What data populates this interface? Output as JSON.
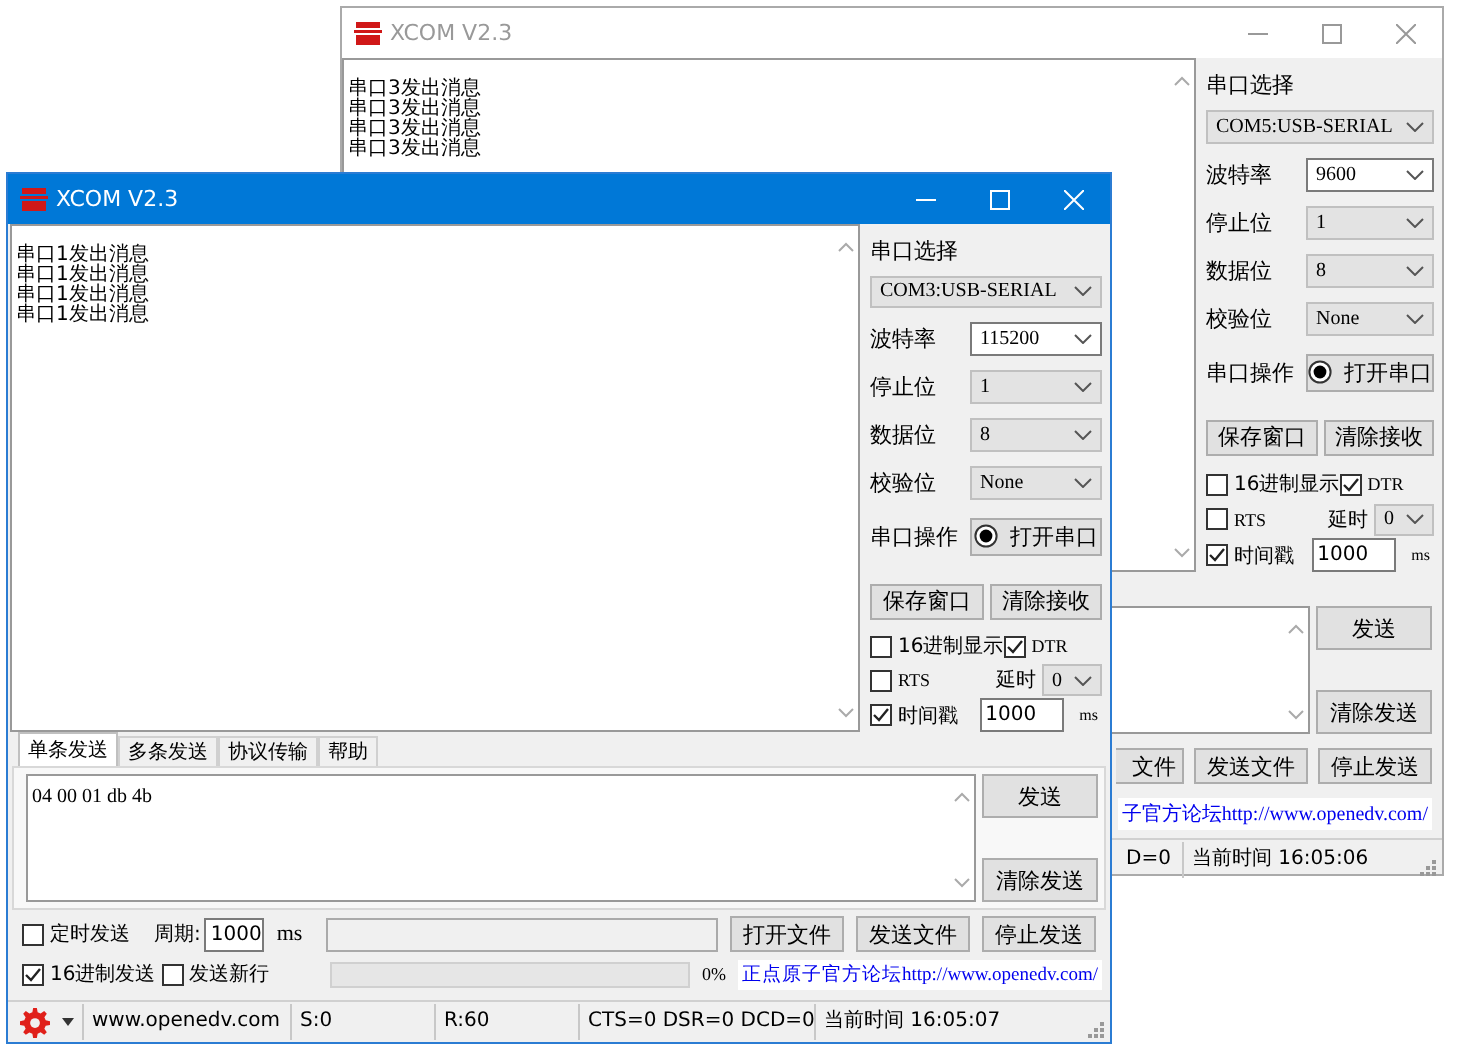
{
  "windows": [
    {
      "active": false,
      "title": "XCOM V2.3",
      "receive_lines": [
        "串口3发出消息",
        "串口3发出消息",
        "串口3发出消息",
        "串口3发出消息"
      ],
      "panel": {
        "title": "串口选择",
        "port": "COM5:USB-SERIAL",
        "settings": [
          {
            "label": "波特率",
            "value": "9600",
            "editable": true
          },
          {
            "label": "停止位",
            "value": "1",
            "editable": false
          },
          {
            "label": "数据位",
            "value": "8",
            "editable": false
          },
          {
            "label": "校验位",
            "value": "None",
            "editable": false
          }
        ],
        "operate_label": "串口操作",
        "open_button": "打开串口",
        "buttons": [
          "保存窗口",
          "清除接收"
        ],
        "hex_display": {
          "label": "16进制显示",
          "checked": false
        },
        "dtr": {
          "label": "DTR",
          "checked": true
        },
        "rts": {
          "label": "RTS",
          "checked": false
        },
        "delay_label": "延时",
        "delay_value": "0",
        "timestamp": {
          "label": "时间戳",
          "checked": true
        },
        "timestamp_value": "1000",
        "timestamp_unit": "ms"
      },
      "lower_partial": {
        "send_buttons": [
          "发送",
          "清除发送"
        ],
        "file_buttons": [
          "文件",
          "发送文件",
          "停止发送"
        ],
        "link": "子官方论坛http://www.openedv.com/",
        "status": [
          "D=0",
          "当前时间 16:05:06"
        ]
      }
    },
    {
      "active": true,
      "title": "XCOM V2.3",
      "receive_lines": [
        "串口1发出消息",
        "串口1发出消息",
        "串口1发出消息",
        "串口1发出消息"
      ],
      "panel": {
        "title": "串口选择",
        "port": "COM3:USB-SERIAL",
        "settings": [
          {
            "label": "波特率",
            "value": "115200",
            "editable": true
          },
          {
            "label": "停止位",
            "value": "1",
            "editable": false
          },
          {
            "label": "数据位",
            "value": "8",
            "editable": false
          },
          {
            "label": "校验位",
            "value": "None",
            "editable": false
          }
        ],
        "operate_label": "串口操作",
        "open_button": "打开串口",
        "buttons": [
          "保存窗口",
          "清除接收"
        ],
        "hex_display": {
          "label": "16进制显示",
          "checked": false
        },
        "dtr": {
          "label": "DTR",
          "checked": true
        },
        "rts": {
          "label": "RTS",
          "checked": false
        },
        "delay_label": "延时",
        "delay_value": "0",
        "timestamp": {
          "label": "时间戳",
          "checked": true
        },
        "timestamp_value": "1000",
        "timestamp_unit": "ms"
      },
      "tabs": [
        {
          "label": "单条发送",
          "selected": true
        },
        {
          "label": "多条发送",
          "selected": false
        },
        {
          "label": "协议传输",
          "selected": false
        },
        {
          "label": "帮助",
          "selected": false
        }
      ],
      "send_text": "04 00 01 db 4b",
      "send_buttons": [
        "发送",
        "清除发送"
      ],
      "timed_send": {
        "label": "定时发送",
        "checked": false
      },
      "period_label": "周期:",
      "period_value": "1000",
      "period_unit": "ms",
      "file_buttons": [
        "打开文件",
        "发送文件",
        "停止发送"
      ],
      "hex_send": {
        "label": "16进制发送",
        "checked": true
      },
      "send_newline": {
        "label": "发送新行",
        "checked": false
      },
      "progress": {
        "level": 0,
        "text": "0%"
      },
      "link": "正点原子官方论坛http://www.openedv.com/",
      "status": {
        "site": "www.openedv.com",
        "sent": "S:0",
        "received": "R:60",
        "lines": "CTS=0 DSR=0 DCD=0",
        "time": "当前时间 16:05:07"
      }
    }
  ]
}
